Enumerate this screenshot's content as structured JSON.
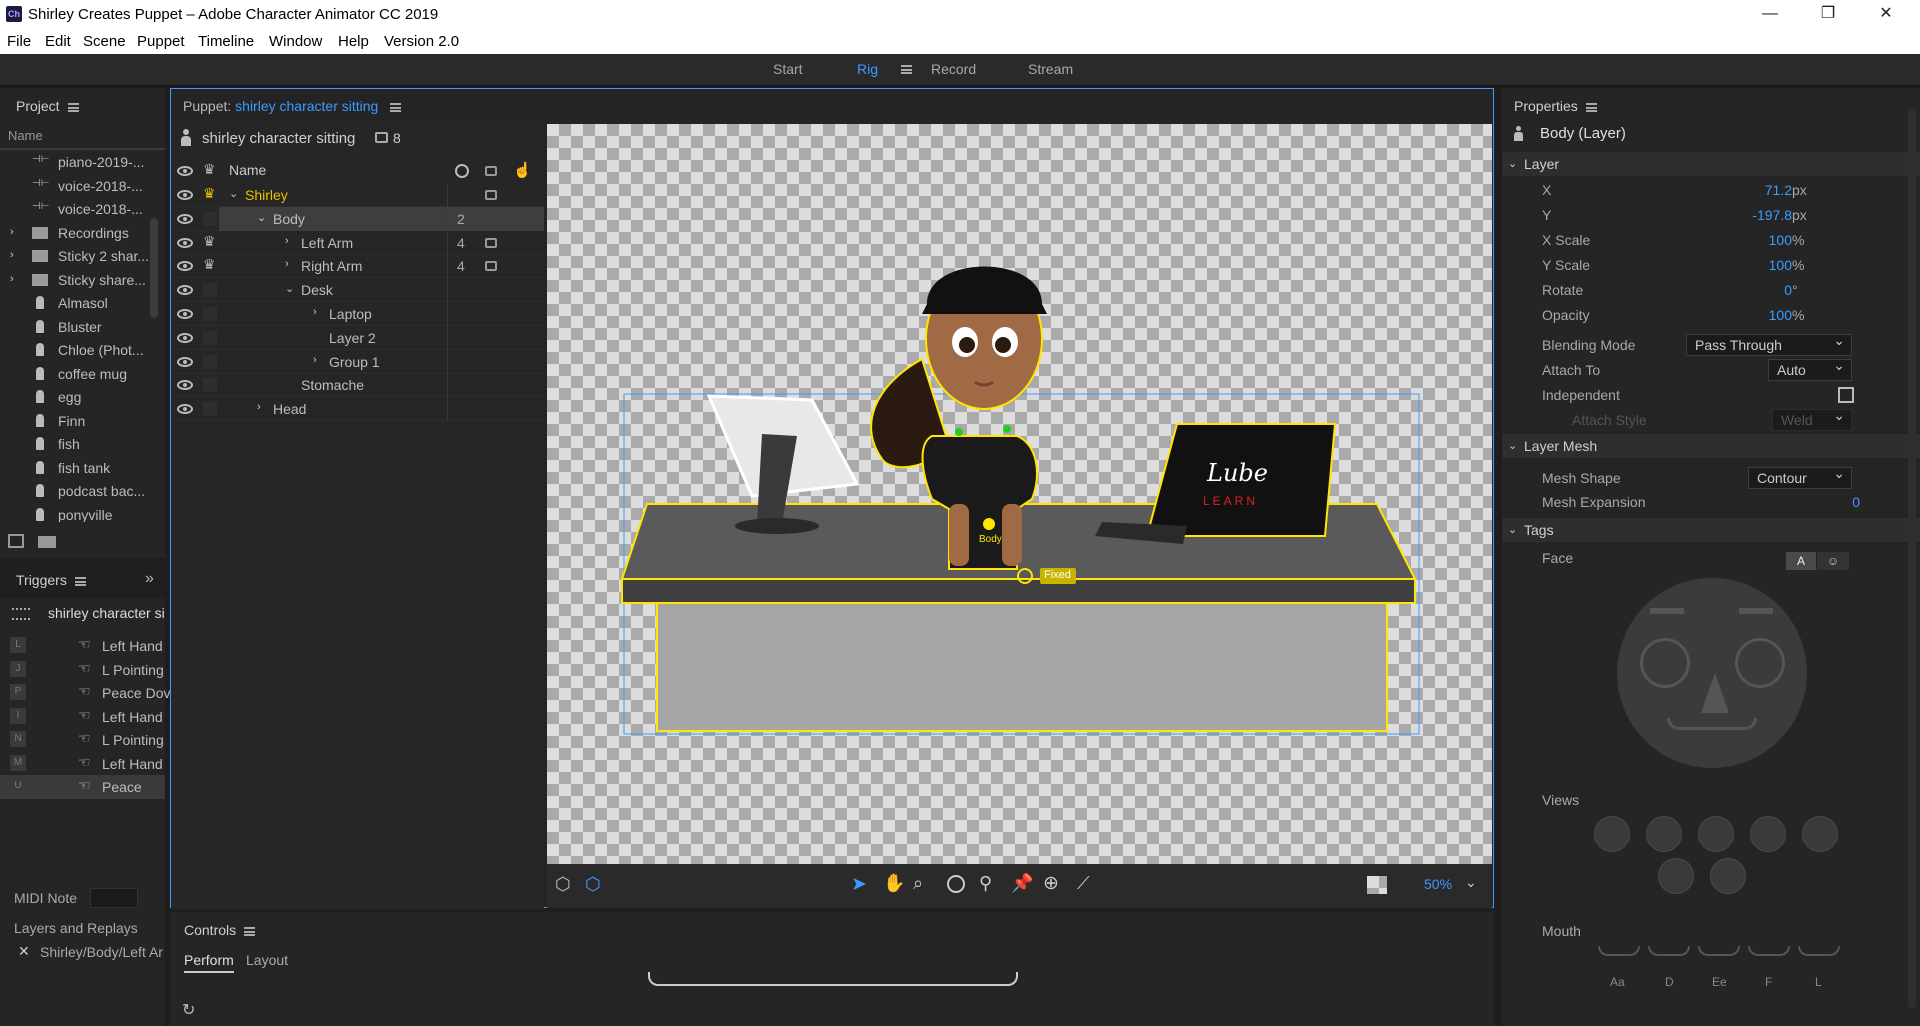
{
  "window": {
    "title": "Shirley Creates Puppet – Adobe Character Animator CC 2019",
    "app_icon": "Ch",
    "minimize": "—",
    "maximize": "❐",
    "close": "✕"
  },
  "menu": [
    "File",
    "Edit",
    "Scene",
    "Puppet",
    "Timeline",
    "Window",
    "Help",
    "Version 2.0"
  ],
  "workspace": {
    "tabs": [
      "Start",
      "Rig",
      "Record",
      "Stream"
    ],
    "active": "Rig"
  },
  "project": {
    "title": "Project",
    "col": "Name",
    "items": [
      {
        "label": "piano-2019-...",
        "icon": "audio"
      },
      {
        "label": "voice-2018-...",
        "icon": "audio"
      },
      {
        "label": "voice-2018-...",
        "icon": "audio"
      },
      {
        "label": "Recordings",
        "icon": "folder"
      },
      {
        "label": "Sticky 2 shar...",
        "icon": "folder"
      },
      {
        "label": "Sticky share...",
        "icon": "folder"
      },
      {
        "label": "Almasol",
        "icon": "puppet"
      },
      {
        "label": "Bluster",
        "icon": "puppet"
      },
      {
        "label": "Chloe (Phot...",
        "icon": "puppet"
      },
      {
        "label": "coffee mug",
        "icon": "puppet"
      },
      {
        "label": "egg",
        "icon": "puppet"
      },
      {
        "label": "Finn",
        "icon": "puppet"
      },
      {
        "label": "fish",
        "icon": "puppet"
      },
      {
        "label": "fish tank",
        "icon": "puppet"
      },
      {
        "label": "podcast bac...",
        "icon": "puppet"
      },
      {
        "label": "ponyville",
        "icon": "puppet"
      }
    ]
  },
  "triggers": {
    "title": "Triggers",
    "puppet": "shirley character si",
    "items": [
      {
        "key": "L",
        "label": "Left Hand"
      },
      {
        "key": "J",
        "label": "L Pointing"
      },
      {
        "key": "P",
        "label": "Peace Dov"
      },
      {
        "key": "I",
        "label": "Left Hand"
      },
      {
        "key": "N",
        "label": "L Pointing"
      },
      {
        "key": "M",
        "label": "Left Hand"
      },
      {
        "key": "U",
        "label": "Peace"
      }
    ],
    "midi_label": "MIDI Note",
    "layers_replays": "Layers and Replays",
    "replay_item": "Shirley/Body/Left Ar"
  },
  "puppet_panel": {
    "prefix": "Puppet:",
    "name": "shirley character sitting",
    "header_name": "shirley character sitting",
    "count": "8",
    "col_name": "Name",
    "layers": [
      {
        "label": "Shirley",
        "indent": 0,
        "chev": "⌄",
        "crown": "gold",
        "num": "",
        "cam": true
      },
      {
        "label": "Body",
        "indent": 1,
        "chev": "⌄",
        "crown": "",
        "num": "2",
        "cam": false,
        "selected": true
      },
      {
        "label": "Left Arm",
        "indent": 2,
        "chev": "›",
        "crown": "white",
        "num": "4",
        "cam": true
      },
      {
        "label": "Right Arm",
        "indent": 2,
        "chev": "›",
        "crown": "white",
        "num": "4",
        "cam": true
      },
      {
        "label": "Desk",
        "indent": 2,
        "chev": "⌄",
        "crown": "",
        "num": "",
        "cam": false
      },
      {
        "label": "Laptop",
        "indent": 3,
        "chev": "›",
        "crown": "",
        "num": "",
        "cam": false
      },
      {
        "label": "Layer 2",
        "indent": 3,
        "chev": "",
        "crown": "",
        "num": "",
        "cam": false
      },
      {
        "label": "Group 1",
        "indent": 3,
        "chev": "›",
        "crown": "",
        "num": "",
        "cam": false
      },
      {
        "label": "Stomache",
        "indent": 2,
        "chev": "",
        "crown": "",
        "num": "",
        "cam": false
      },
      {
        "label": "Head",
        "indent": 1,
        "chev": "›",
        "crown": "",
        "num": "",
        "cam": false
      }
    ],
    "canvas_labels": {
      "body_handle": "Body",
      "fixed_tag": "Fixed",
      "laptop_text": "Lube",
      "laptop_sub": "LEARN"
    },
    "zoom": "50%"
  },
  "properties": {
    "title": "Properties",
    "layer_title": "Body (Layer)",
    "layer_section": "Layer",
    "fields": [
      {
        "label": "X",
        "value": "71.2",
        "unit": "px"
      },
      {
        "label": "Y",
        "value": "-197.8",
        "unit": "px"
      },
      {
        "label": "X Scale",
        "value": "100",
        "unit": "%"
      },
      {
        "label": "Y Scale",
        "value": "100",
        "unit": "%"
      },
      {
        "label": "Rotate",
        "value": "0",
        "unit": "°"
      },
      {
        "label": "Opacity",
        "value": "100",
        "unit": "%"
      }
    ],
    "blending_label": "Blending Mode",
    "blending_value": "Pass Through",
    "attach_label": "Attach To",
    "attach_value": "Auto",
    "independent_label": "Independent",
    "attach_style_label": "Attach Style",
    "attach_style_value": "Weld",
    "mesh_section": "Layer Mesh",
    "mesh_shape_label": "Mesh Shape",
    "mesh_shape_value": "Contour",
    "mesh_exp_label": "Mesh Expansion",
    "mesh_exp_value": "0",
    "tags_section": "Tags",
    "face_label": "Face",
    "face_btn": "A",
    "views_label": "Views",
    "mouth_label": "Mouth",
    "mouths": [
      "Aa",
      "D",
      "Ee",
      "F",
      "L"
    ]
  },
  "controls": {
    "title": "Controls",
    "tabs": [
      "Perform",
      "Layout"
    ],
    "active": "Perform"
  },
  "colors": {
    "accent": "#3d9aff",
    "selection": "#ffe500",
    "panel": "#252525"
  }
}
